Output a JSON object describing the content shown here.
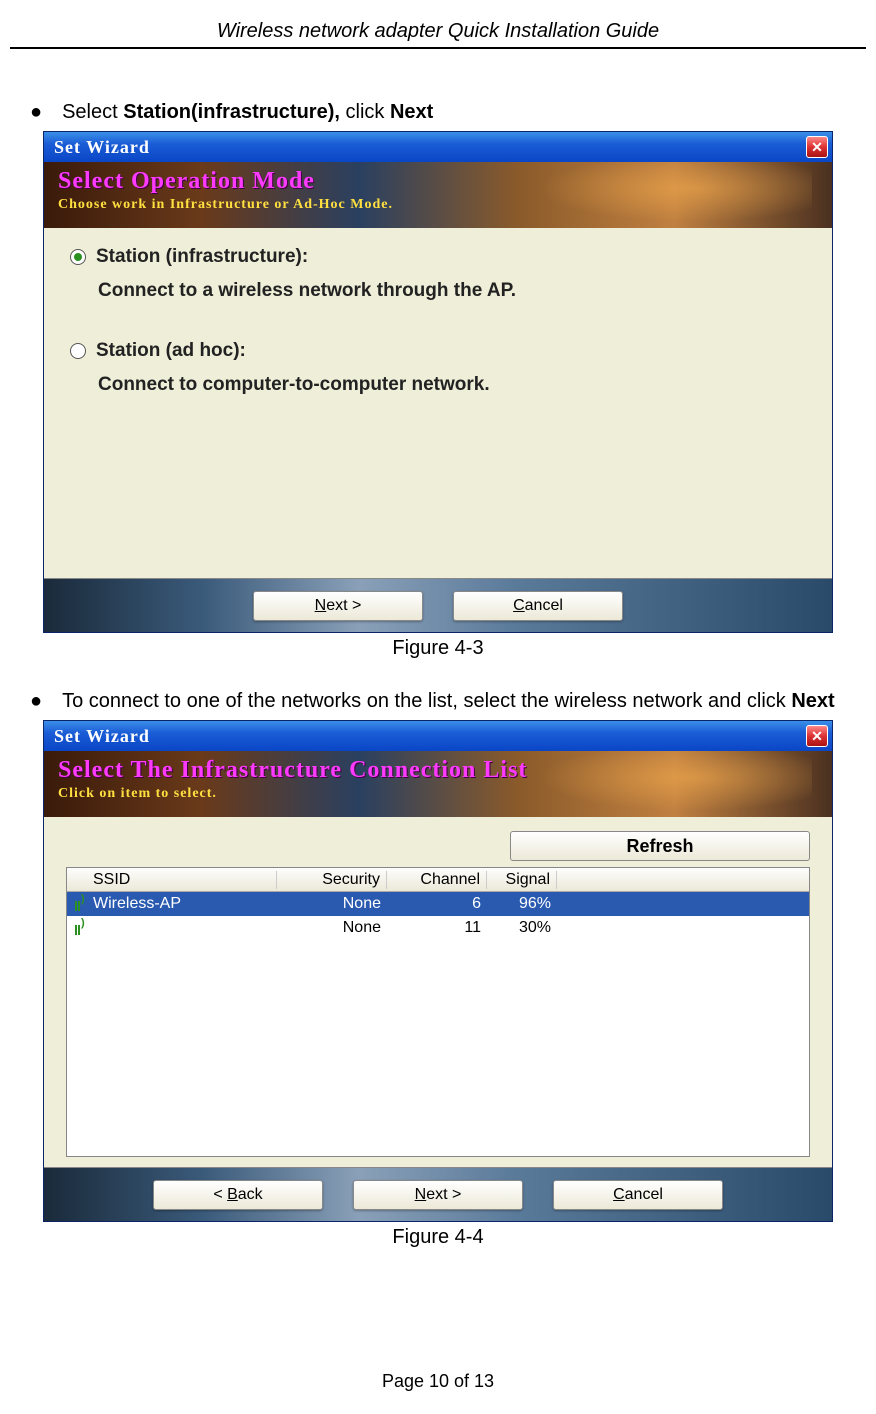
{
  "doc": {
    "header": "Wireless network adapter Quick Installation Guide",
    "footer": "Page 10 of 13"
  },
  "bullet1": {
    "pre": "Select ",
    "bold1": "Station(infrastructure),",
    "mid": " click ",
    "bold2": "Next"
  },
  "bullet2": {
    "pre": "To connect to one of the networks on the list, select the wireless network and click ",
    "bold1": "Next"
  },
  "fig1": {
    "caption": "Figure 4-3",
    "title": "Set Wizard",
    "banner_title": "Select Operation Mode",
    "banner_sub": "Choose work in Infrastructure or Ad-Hoc Mode.",
    "opt1_label": "Station (infrastructure):",
    "opt1_desc": "Connect to a wireless network through the AP.",
    "opt2_label": "Station (ad hoc):",
    "opt2_desc": "Connect to computer-to-computer network.",
    "next_label": "Next >",
    "cancel_label": "Cancel"
  },
  "fig2": {
    "caption": "Figure 4-4",
    "title": "Set Wizard",
    "banner_title": "Select The Infrastructure Connection List",
    "banner_sub": "Click on item to select.",
    "refresh_label": "Refresh",
    "headers": {
      "ssid": "SSID",
      "security": "Security",
      "channel": "Channel",
      "signal": "Signal"
    },
    "rows": [
      {
        "ssid": "Wireless-AP",
        "security": "None",
        "channel": "6",
        "signal": "96%",
        "selected": true
      },
      {
        "ssid": "",
        "security": "None",
        "channel": "11",
        "signal": "30%",
        "selected": false
      }
    ],
    "back_label": "< Back",
    "next_label": "Next >",
    "cancel_label": "Cancel"
  }
}
